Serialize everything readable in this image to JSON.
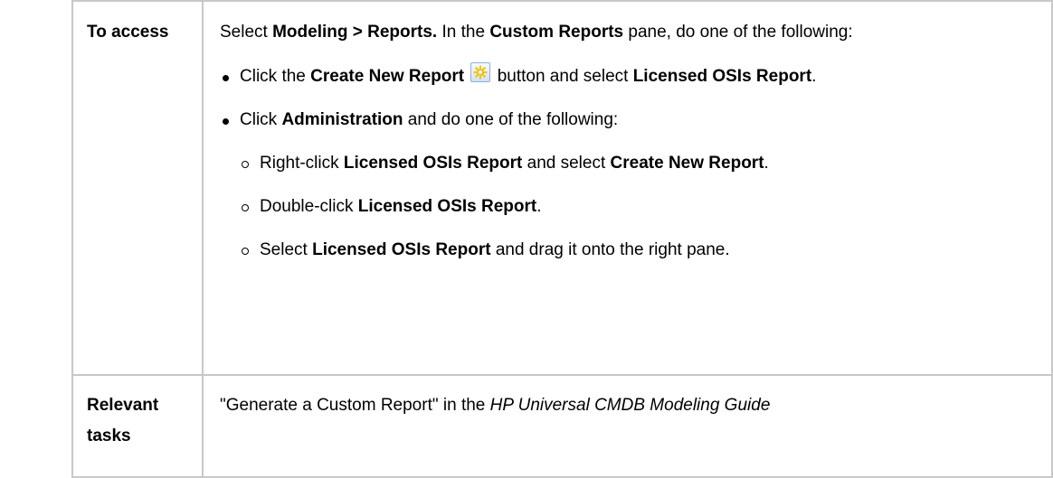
{
  "table": {
    "row1": {
      "label": "To access",
      "intro": {
        "pre1": "Select ",
        "menu_path": "Modeling > Reports.",
        "pre2": " In the ",
        "pane": "Custom Reports",
        "post": " pane, do one of the following:"
      },
      "bullets": [
        {
          "pre": "Click the ",
          "b1": "Create New Report",
          "icon": "create-new-report-icon",
          "mid": " button and select ",
          "b2": "Licensed OSIs Report",
          "post": "."
        },
        {
          "pre": "Click ",
          "b1": "Administration",
          "post": " and do one of the following:",
          "sub": [
            {
              "pre": "Right-click ",
              "b1": "Licensed OSIs Report",
              "mid": " and select ",
              "b2": "Create New Report",
              "post": "."
            },
            {
              "pre": "Double-click ",
              "b1": "Licensed OSIs Report",
              "post": "."
            },
            {
              "pre": "Select ",
              "b1": "Licensed OSIs Report",
              "post": " and drag it onto the right pane."
            }
          ]
        }
      ]
    },
    "row2": {
      "label": "Relevant tasks",
      "quote": "\"Generate a Custom Report\" in the ",
      "guide": "HP Universal CMDB Modeling Guide"
    }
  },
  "colors": {
    "border": "#c8c8c8",
    "text": "#000000",
    "icon_star": "#f5c400"
  }
}
